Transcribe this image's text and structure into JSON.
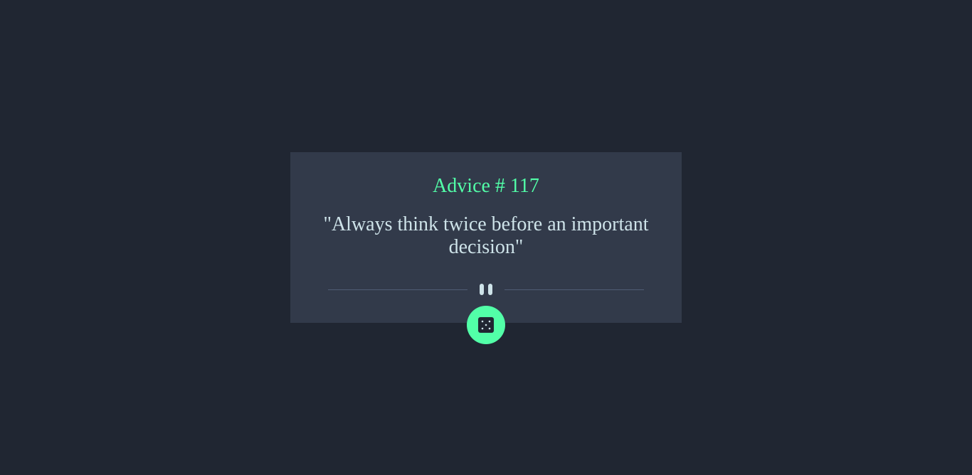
{
  "advice": {
    "id_label": "Advice # 117",
    "text": "\"Always think twice before an important decision\""
  },
  "divider": {
    "icon": "pause-icon"
  },
  "dice_button": {
    "icon": "dice-icon"
  },
  "colors": {
    "background": "#202632",
    "card": "#323a4a",
    "accent": "#52ffa8",
    "text": "#cee3e9",
    "divider": "#4f5d74"
  }
}
